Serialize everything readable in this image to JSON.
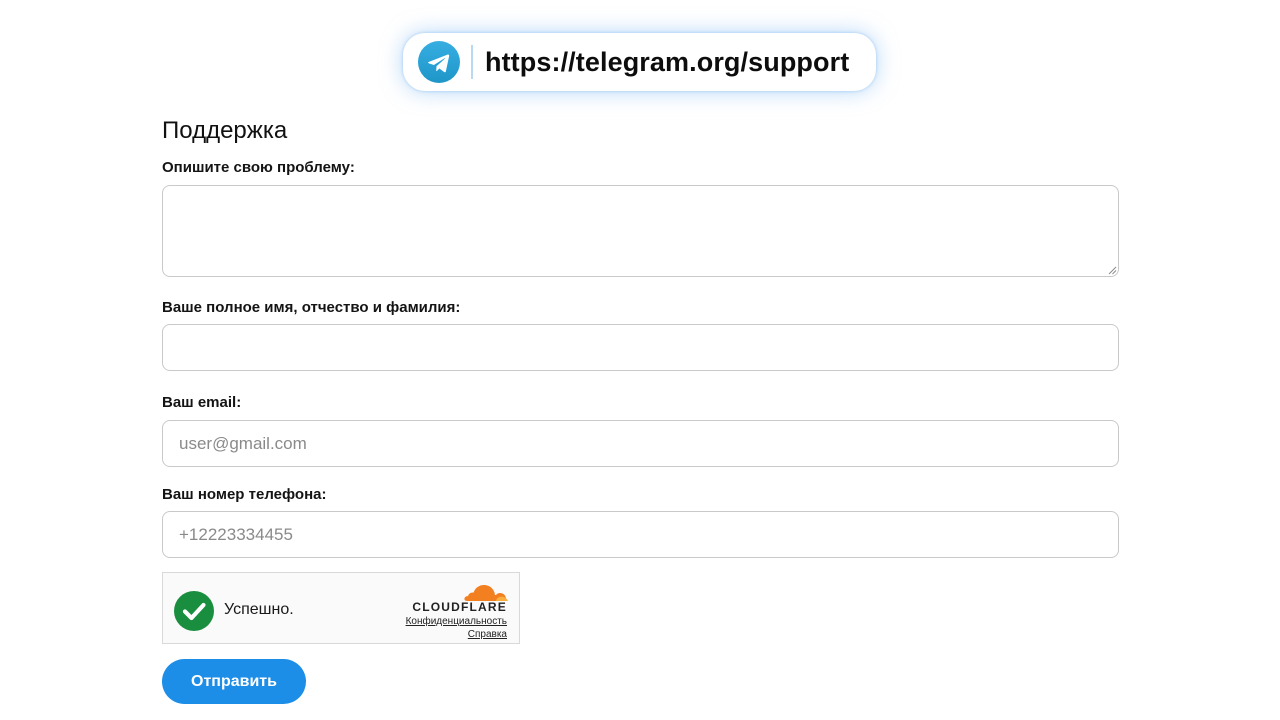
{
  "url_bar": {
    "icon": "telegram-icon",
    "url": "https://telegram.org/support"
  },
  "page": {
    "title": "Поддержка"
  },
  "form": {
    "problem_label": "Опишите свою проблему:",
    "problem_value": "",
    "name_label": "Ваше полное имя, отчество и фамилия:",
    "name_value": "",
    "email_label": "Ваш email:",
    "email_placeholder": "user@gmail.com",
    "phone_label": "Ваш номер телефона:",
    "phone_placeholder": "+12223334455"
  },
  "captcha": {
    "status": "Успешно.",
    "status_icon": "check-icon",
    "brand": "CLOUDFLARE",
    "privacy_link": "Конфиденциальность",
    "help_link": "Справка"
  },
  "submit": {
    "label": "Отправить"
  },
  "colors": {
    "accent": "#1d8ee8",
    "telegram": "#2aa3dc",
    "success": "#1a8e3f",
    "cloudflare": "#f38020"
  }
}
